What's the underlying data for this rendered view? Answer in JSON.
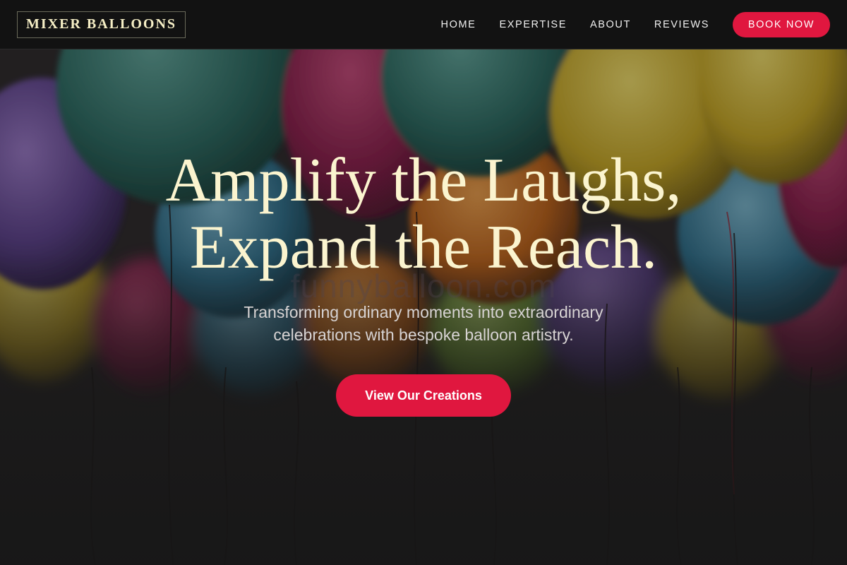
{
  "header": {
    "logo": "MIXER BALLOONS",
    "nav": [
      {
        "label": "HOME"
      },
      {
        "label": "EXPERTISE"
      },
      {
        "label": "ABOUT"
      },
      {
        "label": "REVIEWS"
      }
    ],
    "book_label": "BOOK NOW"
  },
  "hero": {
    "headline_line1": "Amplify the Laughs,",
    "headline_line2": "Expand the Reach.",
    "subtitle_line1": "Transforming ordinary moments into extraordinary",
    "subtitle_line2": "celebrations with bespoke balloon artistry.",
    "cta_label": "View Our Creations",
    "watermark": "funnyballoon.com"
  },
  "colors": {
    "accent": "#e0173f",
    "headline": "#fbf4cf",
    "header_bg": "#121212"
  }
}
